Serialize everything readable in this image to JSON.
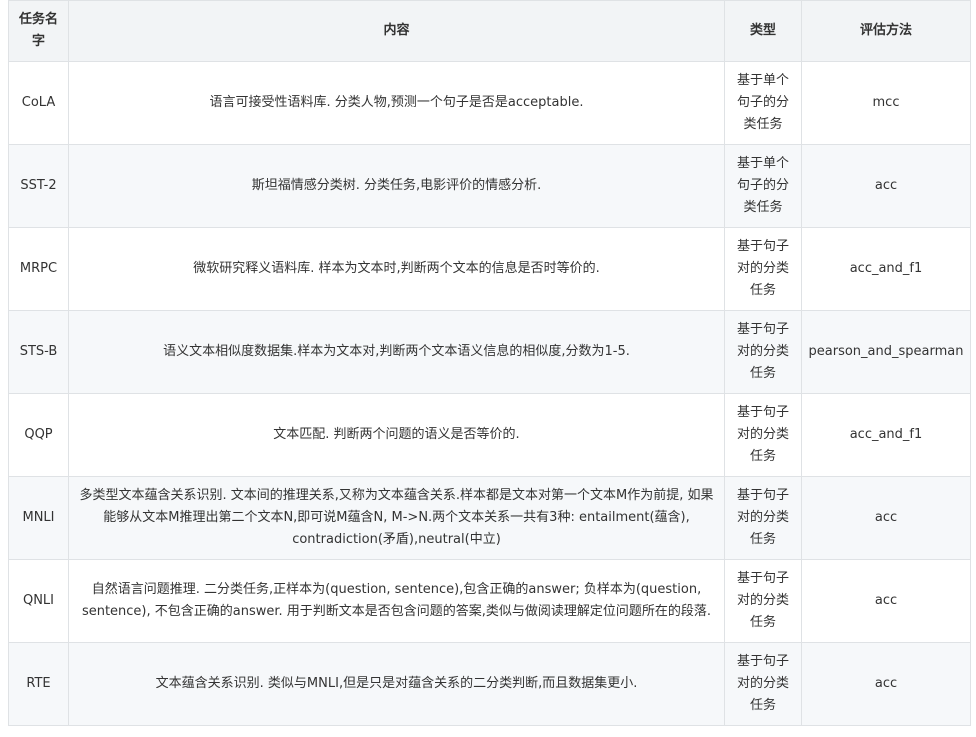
{
  "table": {
    "headers": {
      "name": "任务名字",
      "content": "内容",
      "type": "类型",
      "metric": "评估方法"
    },
    "rows": [
      {
        "name": "CoLA",
        "content": "语言可接受性语料库. 分类人物,预测一个句子是否是acceptable.",
        "type": "基于单个句子的分类任务",
        "metric": "mcc"
      },
      {
        "name": "SST-2",
        "content": "斯坦福情感分类树. 分类任务,电影评价的情感分析.",
        "type": "基于单个句子的分类任务",
        "metric": "acc"
      },
      {
        "name": "MRPC",
        "content": "微软研究释义语料库. 样本为文本时,判断两个文本的信息是否时等价的.",
        "type": "基于句子对的分类任务",
        "metric": "acc_and_f1"
      },
      {
        "name": "STS-B",
        "content": "语义文本相似度数据集.样本为文本对,判断两个文本语义信息的相似度,分数为1-5.",
        "type": "基于句子对的分类任务",
        "metric": "pearson_and_spearman"
      },
      {
        "name": "QQP",
        "content": "文本匹配. 判断两个问题的语义是否等价的.",
        "type": "基于句子对的分类任务",
        "metric": "acc_and_f1"
      },
      {
        "name": "MNLI",
        "content": "多类型文本蕴含关系识别. 文本间的推理关系,又称为文本蕴含关系.样本都是文本对第一个文本M作为前提, 如果能够从文本M推理出第二个文本N,即可说M蕴含N, M->N.两个文本关系一共有3种: entailment(蕴含), contradiction(矛盾),neutral(中立)",
        "type": "基于句子对的分类任务",
        "metric": "acc"
      },
      {
        "name": "QNLI",
        "content": "自然语言问题推理. 二分类任务,正样本为(question, sentence),包含正确的answer; 负样本为(question, sentence), 不包含正确的answer. 用于判断文本是否包含问题的答案,类似与做阅读理解定位问题所在的段落.",
        "type": "基于句子对的分类任务",
        "metric": "acc"
      },
      {
        "name": "RTE",
        "content": "文本蕴含关系识别. 类似与MNLI,但是只是对蕴含关系的二分类判断,而且数据集更小.",
        "type": "基于句子对的分类任务",
        "metric": "acc"
      }
    ]
  }
}
